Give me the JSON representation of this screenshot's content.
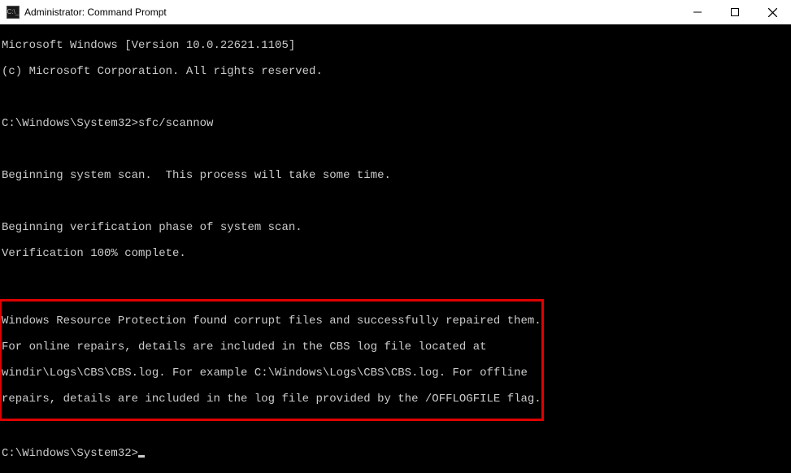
{
  "window": {
    "title": "Administrator: Command Prompt",
    "icon_label": "C:\\_"
  },
  "terminal": {
    "line1": "Microsoft Windows [Version 10.0.22621.1105]",
    "line2": "(c) Microsoft Corporation. All rights reserved.",
    "blank1": "",
    "prompt1_path": "C:\\Windows\\System32>",
    "prompt1_cmd": "sfc/scannow",
    "blank2": "",
    "line3": "Beginning system scan.  This process will take some time.",
    "blank3": "",
    "line4": "Beginning verification phase of system scan.",
    "line5": "Verification 100% complete.",
    "blank4": "",
    "result": {
      "r1": "Windows Resource Protection found corrupt files and successfully repaired them.",
      "r2": "For online repairs, details are included in the CBS log file located at",
      "r3": "windir\\Logs\\CBS\\CBS.log. For example C:\\Windows\\Logs\\CBS\\CBS.log. For offline",
      "r4": "repairs, details are included in the log file provided by the /OFFLOGFILE flag."
    },
    "blank5": "",
    "prompt2_path": "C:\\Windows\\System32>"
  }
}
